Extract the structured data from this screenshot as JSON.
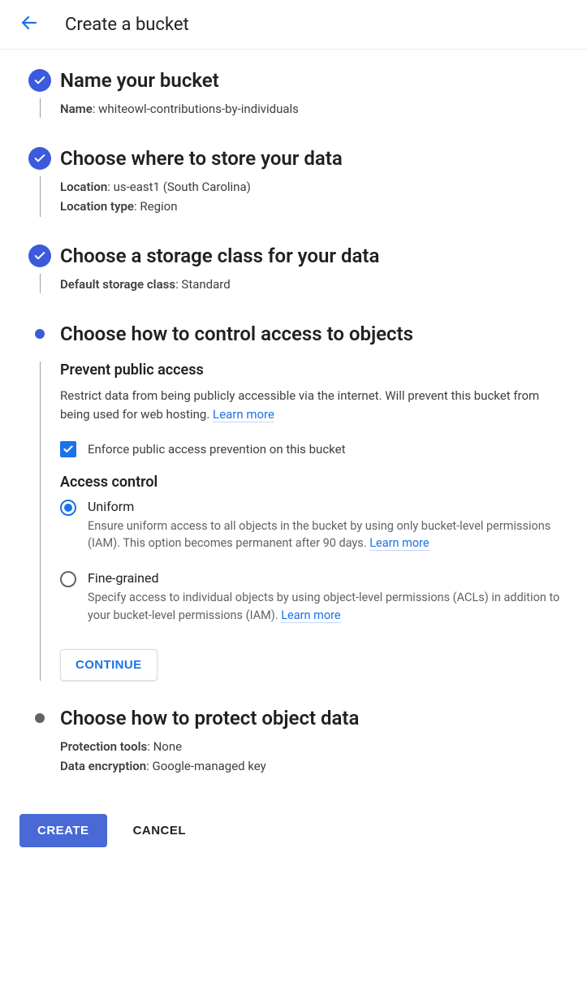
{
  "header": {
    "title": "Create a bucket"
  },
  "steps": {
    "name": {
      "title": "Name your bucket",
      "label": "Name",
      "value": "whiteowl-contributions-by-individuals"
    },
    "location": {
      "title": "Choose where to store your data",
      "loc_label": "Location",
      "loc_value": "us-east1 (South Carolina)",
      "type_label": "Location type",
      "type_value": "Region"
    },
    "storage_class": {
      "title": "Choose a storage class for your data",
      "label": "Default storage class",
      "value": "Standard"
    },
    "access": {
      "title": "Choose how to control access to objects",
      "prevent_title": "Prevent public access",
      "prevent_desc": "Restrict data from being publicly accessible via the internet. Will prevent this bucket from being used for web hosting. ",
      "learn_more": "Learn more",
      "checkbox_label": "Enforce public access prevention on this bucket",
      "ac_title": "Access control",
      "uniform_label": "Uniform",
      "uniform_desc": "Ensure uniform access to all objects in the bucket by using only bucket-level permissions (IAM). This option becomes permanent after 90 days. ",
      "finegrained_label": "Fine-grained",
      "finegrained_desc": "Specify access to individual objects by using object-level permissions (ACLs) in addition to your bucket-level permissions (IAM). ",
      "continue": "CONTINUE"
    },
    "protect": {
      "title": "Choose how to protect object data",
      "tools_label": "Protection tools",
      "tools_value": "None",
      "enc_label": "Data encryption",
      "enc_value": "Google-managed key"
    }
  },
  "footer": {
    "create": "CREATE",
    "cancel": "CANCEL"
  }
}
